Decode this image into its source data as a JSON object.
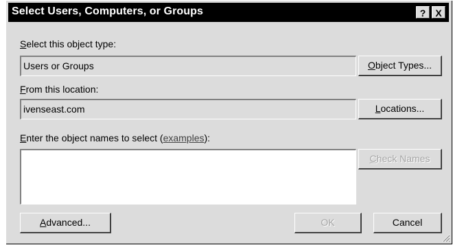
{
  "window": {
    "title": "Select Users, Computers, or Groups",
    "help_glyph": "?",
    "close_glyph": "X"
  },
  "object_type": {
    "label_accel": "S",
    "label_rest": "elect this object type:",
    "value": "Users or Groups",
    "button_accel": "O",
    "button_rest": "bject Types..."
  },
  "location": {
    "label_accel": "F",
    "label_rest": "rom this location:",
    "value": "ivenseast.com",
    "button_accel": "L",
    "button_rest": "ocations..."
  },
  "names": {
    "label_accel": "E",
    "label_rest": "nter the object names to select (",
    "link_text": "examples",
    "label_end": "):",
    "value": "",
    "check_accel": "C",
    "check_rest": "heck Names"
  },
  "footer": {
    "advanced_accel": "A",
    "advanced_rest": "dvanced...",
    "ok_label": "OK",
    "cancel_label": "Cancel"
  },
  "icons": {
    "help": "help-icon",
    "close": "close-icon",
    "resize": "resize-grip-icon"
  },
  "colors": {
    "face": "#dcdcdc",
    "titlebar": "#000000",
    "disabled_text": "#a6a6a6"
  }
}
